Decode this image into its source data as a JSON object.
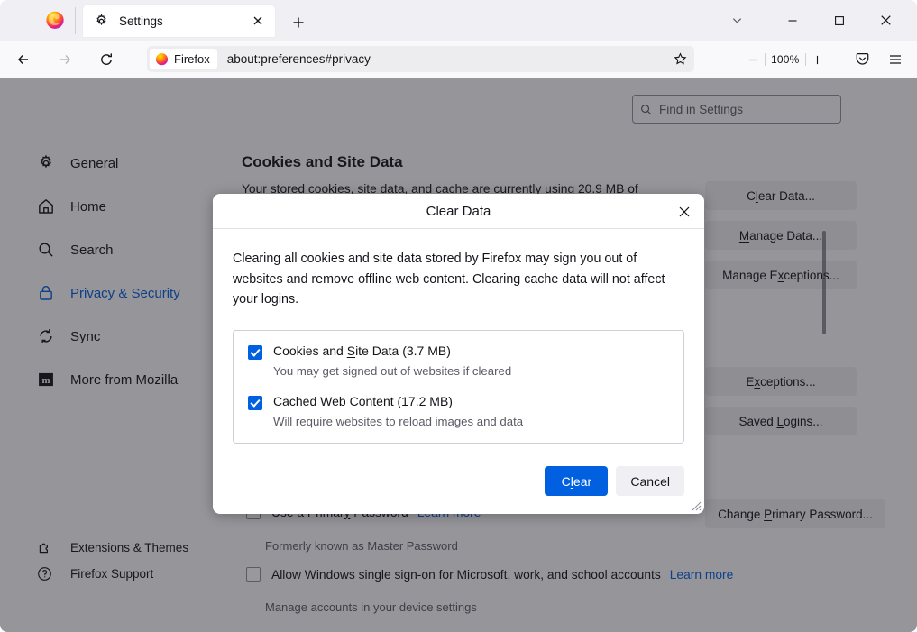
{
  "window": {
    "controls": {
      "tab_list_chevron": "chevron-down",
      "minimize": "minimize",
      "maximize": "maximize",
      "close": "close"
    }
  },
  "tabstrip": {
    "tabs": [
      {
        "title": "Settings",
        "icon": "gear-icon",
        "close_label": "×",
        "active": true
      }
    ],
    "new_tab_label": "+"
  },
  "navbar": {
    "back_label": "←",
    "forward_label": "→",
    "reload_label": "⟳",
    "url_chip_label": "Firefox",
    "url": "about:preferences#privacy",
    "bookmark_star": "☆",
    "zoom_out_label": "−",
    "zoom_value": "100%",
    "zoom_in_label": "+",
    "pocket_label": "pocket-icon",
    "app_menu_label": "hamburger-icon"
  },
  "search": {
    "placeholder": "Find in Settings"
  },
  "sidebar": {
    "items": [
      {
        "label": "General",
        "icon": "gear-icon",
        "selected": false
      },
      {
        "label": "Home",
        "icon": "home-icon",
        "selected": false
      },
      {
        "label": "Search",
        "icon": "magnifier-icon",
        "selected": false
      },
      {
        "label": "Privacy & Security",
        "icon": "lock-icon",
        "selected": true
      },
      {
        "label": "Sync",
        "icon": "sync-icon",
        "selected": false
      },
      {
        "label": "More from Mozilla",
        "icon": "mozilla-m-icon",
        "selected": false
      }
    ],
    "bottom_items": [
      {
        "label": "Extensions & Themes",
        "icon": "puzzle-icon"
      },
      {
        "label": "Firefox Support",
        "icon": "question-circle-icon"
      }
    ]
  },
  "settings_page": {
    "cookies_heading": "Cookies and Site Data",
    "cookies_desc": "Your stored cookies, site data, and cache are currently using 20.9 MB of",
    "buttons": {
      "clear_data": "Clear Data...",
      "manage_data": "Manage Data...",
      "manage_exceptions": "Manage Exceptions...",
      "exceptions": "Exceptions...",
      "saved_logins": "Saved Logins...",
      "change_primary_password": "Change Primary Password..."
    },
    "primary_password_row": {
      "label": "Use a Primary Password",
      "link": "Learn more",
      "sub": "Formerly known as Master Password"
    },
    "sso_row": {
      "label": "Allow Windows single sign-on for Microsoft, work, and school accounts",
      "link": "Learn more",
      "sub": "Manage accounts in your device settings"
    }
  },
  "dialog": {
    "title": "Clear Data",
    "close_label": "×",
    "description": "Clearing all cookies and site data stored by Firefox may sign you out of websites and remove offline web content. Clearing cache data will not affect your logins.",
    "options": [
      {
        "label_before": "Cookies and ",
        "accesskey": "S",
        "label_after": "ite Data (3.7 MB)",
        "sublabel": "You may get signed out of websites if cleared",
        "checked": true,
        "size": "3.7 MB"
      },
      {
        "label_before": "Cached ",
        "accesskey": "W",
        "label_after": "eb Content (17.2 MB)",
        "sublabel": "Will require websites to reload images and data",
        "checked": true,
        "size": "17.2 MB"
      }
    ],
    "confirm_before": "C",
    "confirm_accesskey": "l",
    "confirm_after": "ear",
    "cancel_label": "Cancel"
  },
  "colors": {
    "accent": "#0060df",
    "link": "#0060df",
    "toolbar_bg": "#f0f0f4",
    "nav_bg": "#f9f9fb",
    "urlbar_bg": "#ededf0",
    "dim": "rgba(28,27,34,.45)",
    "text": "#15141a",
    "muted_text": "#5b5b66"
  }
}
